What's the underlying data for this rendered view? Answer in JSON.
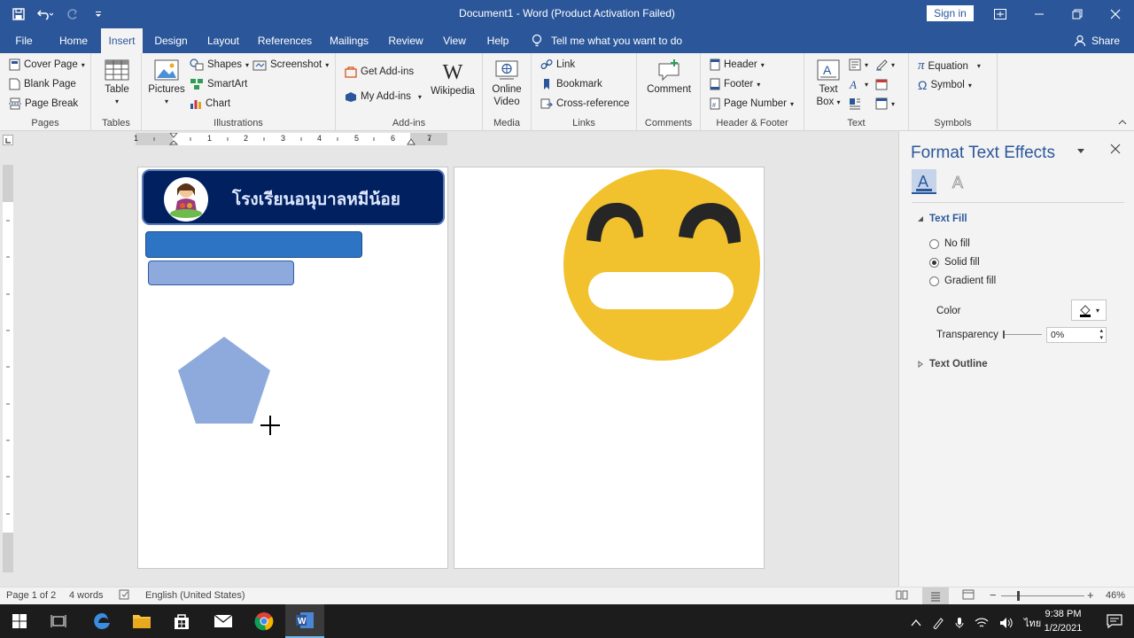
{
  "window": {
    "title": "Document1  -  Word (Product Activation Failed)",
    "signin": "Sign in"
  },
  "tabs": [
    "File",
    "Home",
    "Insert",
    "Design",
    "Layout",
    "References",
    "Mailings",
    "Review",
    "View",
    "Help"
  ],
  "active_tab": "Insert",
  "tellme": "Tell me what you want to do",
  "share": "Share",
  "ribbon": {
    "pages": {
      "label": "Pages",
      "cover": "Cover Page",
      "blank": "Blank Page",
      "break": "Page Break"
    },
    "tables": {
      "label": "Tables",
      "table": "Table"
    },
    "illustrations": {
      "label": "Illustrations",
      "pictures": "Pictures",
      "shapes": "Shapes",
      "smartart": "SmartArt",
      "chart": "Chart",
      "screenshot": "Screenshot"
    },
    "addins": {
      "label": "Add-ins",
      "get": "Get Add-ins",
      "my": "My Add-ins",
      "wikipedia": "Wikipedia",
      "w_glyph": "W"
    },
    "media": {
      "label": "Media",
      "video1": "Online",
      "video2": "Video"
    },
    "links": {
      "label": "Links",
      "link": "Link",
      "bookmark": "Bookmark",
      "crossref": "Cross-reference"
    },
    "comments": {
      "label": "Comments",
      "comment": "Comment"
    },
    "headerfooter": {
      "label": "Header & Footer",
      "header": "Header",
      "footer": "Footer",
      "pagenumber": "Page Number"
    },
    "text": {
      "label": "Text",
      "textbox1": "Text",
      "textbox2": "Box"
    },
    "symbols": {
      "label": "Symbols",
      "equation": "Equation",
      "symbol": "Symbol"
    }
  },
  "ruler": {
    "numbers": [
      "1",
      "1",
      "1",
      "2",
      "3",
      "4",
      "5",
      "6",
      "7"
    ],
    "vnumbers": [
      "1",
      "1",
      "2",
      "3",
      "4",
      "5",
      "6",
      "7",
      "8"
    ]
  },
  "document": {
    "banner_text": "โรงเรียนอนุบาลหมีน้อย",
    "colors": {
      "banner": "#002060",
      "bar1": "#2e74c4",
      "bar2": "#8eaadc",
      "pentagon": "#8eaadc",
      "emoji": "#f2c12e"
    }
  },
  "pane": {
    "title": "Format Text Effects",
    "section_fill": "Text Fill",
    "no_fill": "No fill",
    "solid_fill": "Solid fill",
    "gradient_fill": "Gradient fill",
    "selected_fill": "Solid fill",
    "color_label": "Color",
    "transparency_label": "Transparency",
    "transparency_value": "0%",
    "section_outline": "Text Outline"
  },
  "status": {
    "page": "Page 1 of 2",
    "words": "4 words",
    "language": "English (United States)",
    "zoom": "46%"
  },
  "taskbar": {
    "time": "9:38 PM",
    "date": "1/2/2021",
    "lang": "ไทย"
  }
}
